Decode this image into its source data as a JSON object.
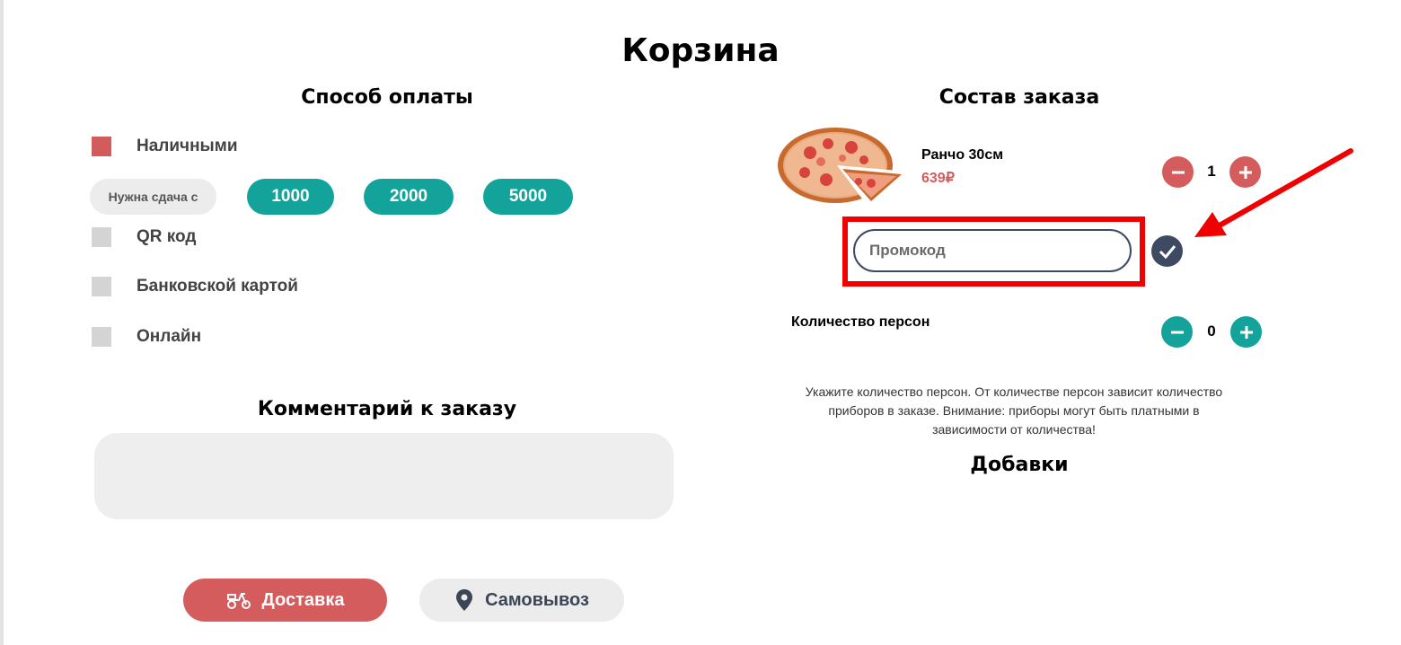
{
  "page": {
    "title": "Корзина"
  },
  "payment": {
    "heading": "Способ оплаты",
    "options": [
      {
        "label": "Наличными",
        "checked": true
      },
      {
        "label": "QR код",
        "checked": false
      },
      {
        "label": "Банковской картой",
        "checked": false
      },
      {
        "label": "Онлайн",
        "checked": false
      }
    ],
    "change": {
      "label": "Нужна сдача с",
      "amounts": [
        "1000",
        "2000",
        "5000"
      ]
    }
  },
  "comment": {
    "heading": "Комментарий к заказу",
    "value": ""
  },
  "order": {
    "heading": "Состав заказа",
    "items": [
      {
        "name": "Ранчо 30см",
        "price": "639₽",
        "quantity": "1"
      }
    ],
    "promo": {
      "placeholder": "Промокод",
      "value": ""
    },
    "persons": {
      "label": "Количество персон",
      "count": "0",
      "note": "Укажите количество персон. От количестве персон зависит количество приборов в заказе. Внимание: приборы могут быть платными в зависимости от количества!"
    },
    "additions_heading": "Добавки"
  },
  "delivery": {
    "delivery_label": "Доставка",
    "pickup_label": "Самовывоз"
  },
  "colors": {
    "accent_red": "#d45c5c",
    "accent_teal": "#14a39b",
    "dark_navy": "#3e4a61",
    "highlight_red": "#f00000"
  }
}
